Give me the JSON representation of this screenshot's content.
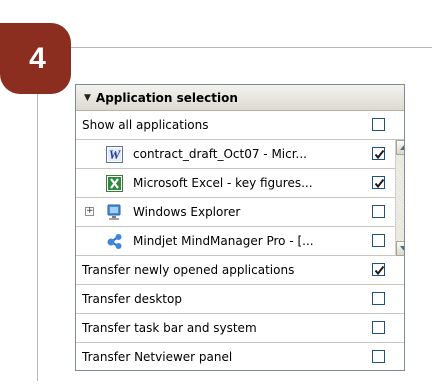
{
  "step": {
    "number": "4"
  },
  "panel": {
    "title": "Application selection",
    "rows": [
      {
        "label": "Show all applications",
        "checked": false
      },
      {
        "label": "contract_draft_Oct07 - Micr...",
        "checked": true,
        "icon": "word-icon"
      },
      {
        "label": "Microsoft Excel - key figures...",
        "checked": true,
        "icon": "excel-icon"
      },
      {
        "label": "Windows Explorer",
        "checked": false,
        "icon": "windows-explorer-icon",
        "expandable": true
      },
      {
        "label": "Mindjet MindManager Pro - [...",
        "checked": false,
        "icon": "mindmanager-icon"
      },
      {
        "label": "Transfer newly opened applications",
        "checked": true
      },
      {
        "label": "Transfer desktop",
        "checked": false
      },
      {
        "label": "Transfer task bar and system",
        "checked": false
      },
      {
        "label": "Transfer Netviewer panel",
        "checked": false
      }
    ]
  },
  "colors": {
    "badge": "#8b2d1f",
    "checkbox_border": "#1c5180",
    "checkmark": "#1b1b1b"
  }
}
